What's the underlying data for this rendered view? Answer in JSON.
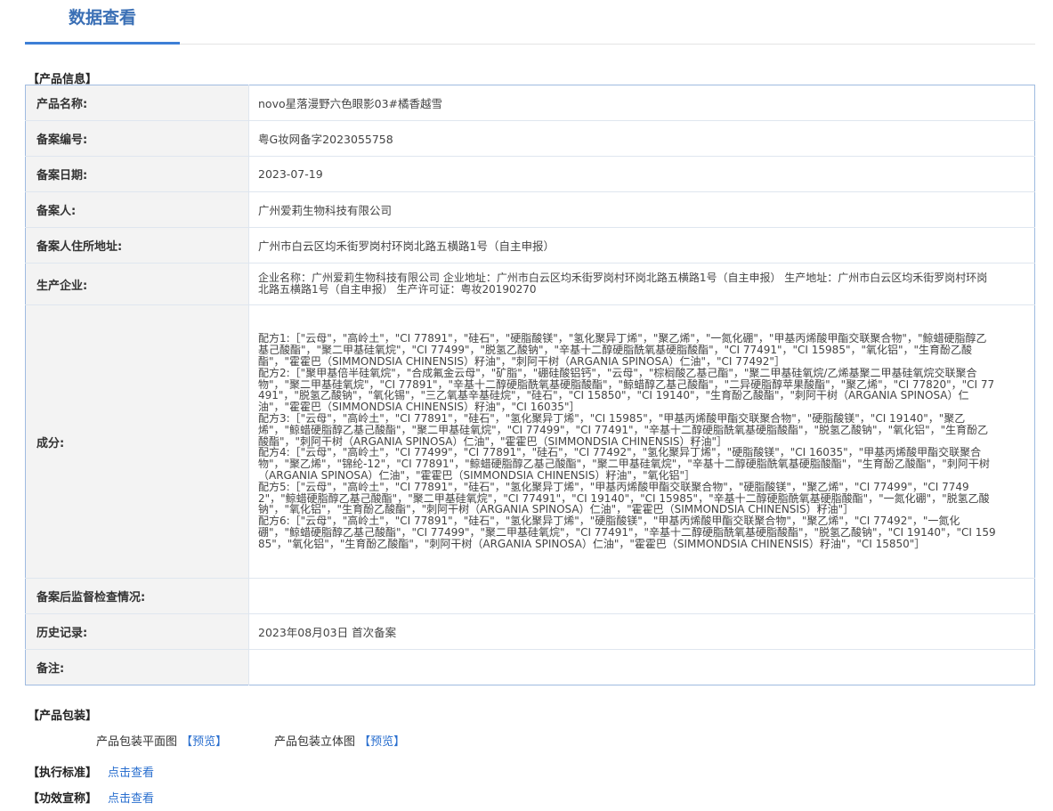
{
  "tab": {
    "label": "数据查看"
  },
  "product_info": {
    "title": "【产品信息】",
    "rows": [
      {
        "label": "产品名称:",
        "value": "novo星落漫野六色眼影03#橘香越雪"
      },
      {
        "label": "备案编号:",
        "value": "粤G妆网备字2023055758"
      },
      {
        "label": "备案日期:",
        "value": "2023-07-19"
      },
      {
        "label": "备案人:",
        "value": "广州爱莉生物科技有限公司"
      },
      {
        "label": "备案人住所地址:",
        "value": "广州市白云区均禾街罗岗村环岗北路五横路1号（自主申报）"
      },
      {
        "label": "生产企业:",
        "value": "企业名称：广州爱莉生物科技有限公司 企业地址：广州市白云区均禾街罗岗村环岗北路五横路1号（自主申报） 生产地址：广州市白云区均禾街罗岗村环岗北路五横路1号（自主申报） 生产许可证：粤妆20190270"
      },
      {
        "label": "成分:",
        "value": ""
      },
      {
        "label": "备案后监督检查情况:",
        "value": ""
      },
      {
        "label": "历史记录:",
        "value": "2023年08月03日 首次备案"
      },
      {
        "label": "备注:",
        "value": ""
      }
    ],
    "formulas": [
      "配方1:［\"云母\"，\"高岭土\"，\"CI 77891\"，\"硅石\"，\"硬脂酸镁\"，\"氢化聚异丁烯\"，\"聚乙烯\"，\"一氮化硼\"，\"甲基丙烯酸甲酯交联聚合物\"，\"鲸蜡硬脂醇乙基己酸酯\"，\"聚二甲基硅氧烷\"，\"CI 77499\"，\"脱氢乙酸钠\"，\"辛基十二醇硬脂酰氧基硬脂酸酯\"，\"CI 77491\"，\"CI 15985\"，\"氧化铝\"，\"生育酚乙酸酯\"，\"霍霍巴（SIMMONDSIA CHINENSIS）籽油\"，\"刺阿干树（ARGANIA SPINOSA）仁油\"，\"CI 77492\"］",
      "配方2:［\"聚甲基倍半硅氧烷\"，\"合成氟金云母\"，\"矿脂\"，\"硼硅酸铝钙\"，\"云母\"，\"棕榈酸乙基己酯\"，\"聚二甲基硅氧烷/乙烯基聚二甲基硅氧烷交联聚合物\"，\"聚二甲基硅氧烷\"，\"CI 77891\"，\"辛基十二醇硬脂酰氧基硬脂酸酯\"，\"鲸蜡醇乙基己酸酯\"，\"二异硬脂醇苹果酸酯\"，\"聚乙烯\"，\"CI 77820\"，\"CI 77491\"，\"脱氢乙酸钠\"，\"氧化锡\"，\"三乙氧基辛基硅烷\"，\"硅石\"，\"CI 15850\"，\"CI 19140\"，\"生育酚乙酸酯\"，\"刺阿干树（ARGANIA SPINOSA）仁油\"，\"霍霍巴（SIMMONDSIA CHINENSIS）籽油\"，\"CI 16035\"］",
      "配方3:［\"云母\"，\"高岭土\"，\"CI 77891\"，\"硅石\"，\"氢化聚异丁烯\"，\"CI 15985\"，\"甲基丙烯酸甲酯交联聚合物\"，\"硬脂酸镁\"，\"CI 19140\"，\"聚乙烯\"，\"鲸蜡硬脂醇乙基己酸酯\"，\"聚二甲基硅氧烷\"，\"CI 77499\"，\"CI 77491\"，\"辛基十二醇硬脂酰氧基硬脂酸酯\"，\"脱氢乙酸钠\"，\"氧化铝\"，\"生育酚乙酸酯\"，\"刺阿干树（ARGANIA SPINOSA）仁油\"，\"霍霍巴（SIMMONDSIA CHINENSIS）籽油\"］",
      "配方4:［\"云母\"，\"高岭土\"，\"CI 77499\"，\"CI 77891\"，\"硅石\"，\"CI 77492\"，\"氢化聚异丁烯\"，\"硬脂酸镁\"，\"CI 16035\"，\"甲基丙烯酸甲酯交联聚合物\"，\"聚乙烯\"，\"锦纶-12\"，\"CI 77891\"，\"鲸蜡硬脂醇乙基己酸酯\"，\"聚二甲基硅氧烷\"，\"辛基十二醇硬脂酰氧基硬脂酸酯\"，\"生育酚乙酸酯\"，\"刺阿干树（ARGANIA SPINOSA）仁油\"，\"霍霍巴（SIMMONDSIA CHINENSIS）籽油\"，\"氧化铝\"］",
      "配方5:［\"云母\"，\"高岭土\"，\"CI 77891\"，\"硅石\"，\"氢化聚异丁烯\"，\"甲基丙烯酸甲酯交联聚合物\"，\"硬脂酸镁\"，\"聚乙烯\"，\"CI 77499\"，\"CI 77492\"，\"鲸蜡硬脂醇乙基己酸酯\"，\"聚二甲基硅氧烷\"，\"CI 77491\"，\"CI 19140\"，\"CI 15985\"，\"辛基十二醇硬脂酰氧基硬脂酸酯\"，\"一氮化硼\"，\"脱氢乙酸钠\"，\"氧化铝\"，\"生育酚乙酸酯\"，\"刺阿干树（ARGANIA SPINOSA）仁油\"，\"霍霍巴（SIMMONDSIA CHINENSIS）籽油\"］",
      "配方6:［\"云母\"，\"高岭土\"，\"CI 77891\"，\"硅石\"，\"氢化聚异丁烯\"，\"硬脂酸镁\"，\"甲基丙烯酸甲酯交联聚合物\"，\"聚乙烯\"，\"CI 77492\"，\"一氮化硼\"，\"鲸蜡硬脂醇乙基己酸酯\"，\"CI 77499\"，\"聚二甲基硅氧烷\"，\"CI 77491\"，\"辛基十二醇硬脂酰氧基硬脂酸酯\"，\"脱氢乙酸钠\"，\"CI 19140\"，\"CI 15985\"，\"氧化铝\"，\"生育酚乙酸酯\"，\"刺阿干树（ARGANIA SPINOSA）仁油\"，\"霍霍巴（SIMMONDSIA CHINENSIS）籽油\"，\"CI 15850\"］"
    ]
  },
  "packaging": {
    "title": "【产品包装】",
    "flat_label": "产品包装平面图",
    "flat_preview": "【预览】",
    "solid_label": "产品包装立体图",
    "solid_preview": "【预览】"
  },
  "standard": {
    "title": "【执行标准】",
    "link": "点击查看"
  },
  "efficacy": {
    "title": "【功效宣称】",
    "link": "点击查看"
  },
  "colors": {
    "accent": "#3d7fd6",
    "link": "#2a6fcf",
    "border": "#9fbbe0",
    "label_bg": "#f3f3f3"
  }
}
